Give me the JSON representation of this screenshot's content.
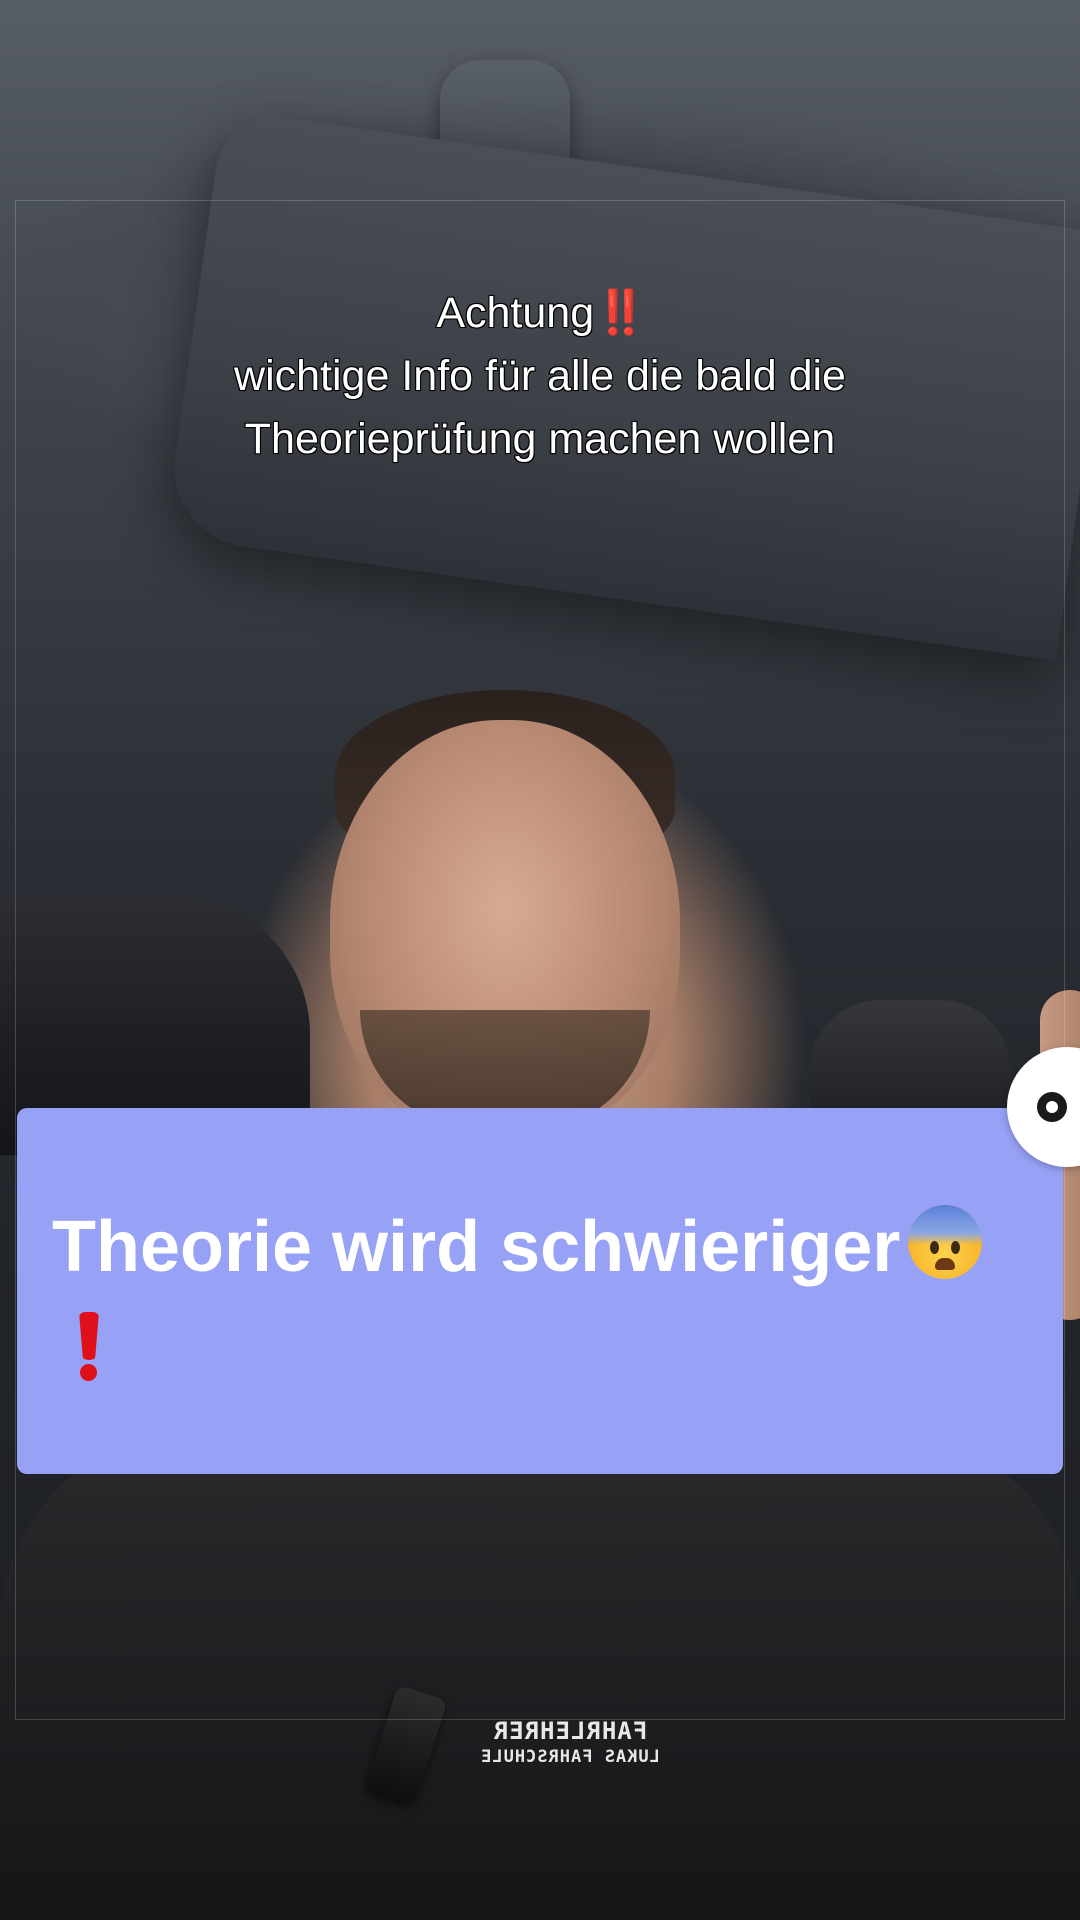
{
  "caption": {
    "line1_text": "Achtung",
    "line1_emoji": "‼️",
    "line2": "wichtige Info für alle die bald die",
    "line3": "Theorieprüfung machen wollen"
  },
  "card": {
    "title": "Theorie wird schwieriger",
    "emoji": "fearful-face-icon",
    "emoji2": "exclamation-mark-icon",
    "background": "#97a1f6"
  },
  "shirt": {
    "line1": "FAHRLEHRER",
    "line2": "LUKAS FAHRSCHULE"
  },
  "colors": {
    "accent_red": "#e0101b",
    "caption_text": "#ffffff"
  }
}
